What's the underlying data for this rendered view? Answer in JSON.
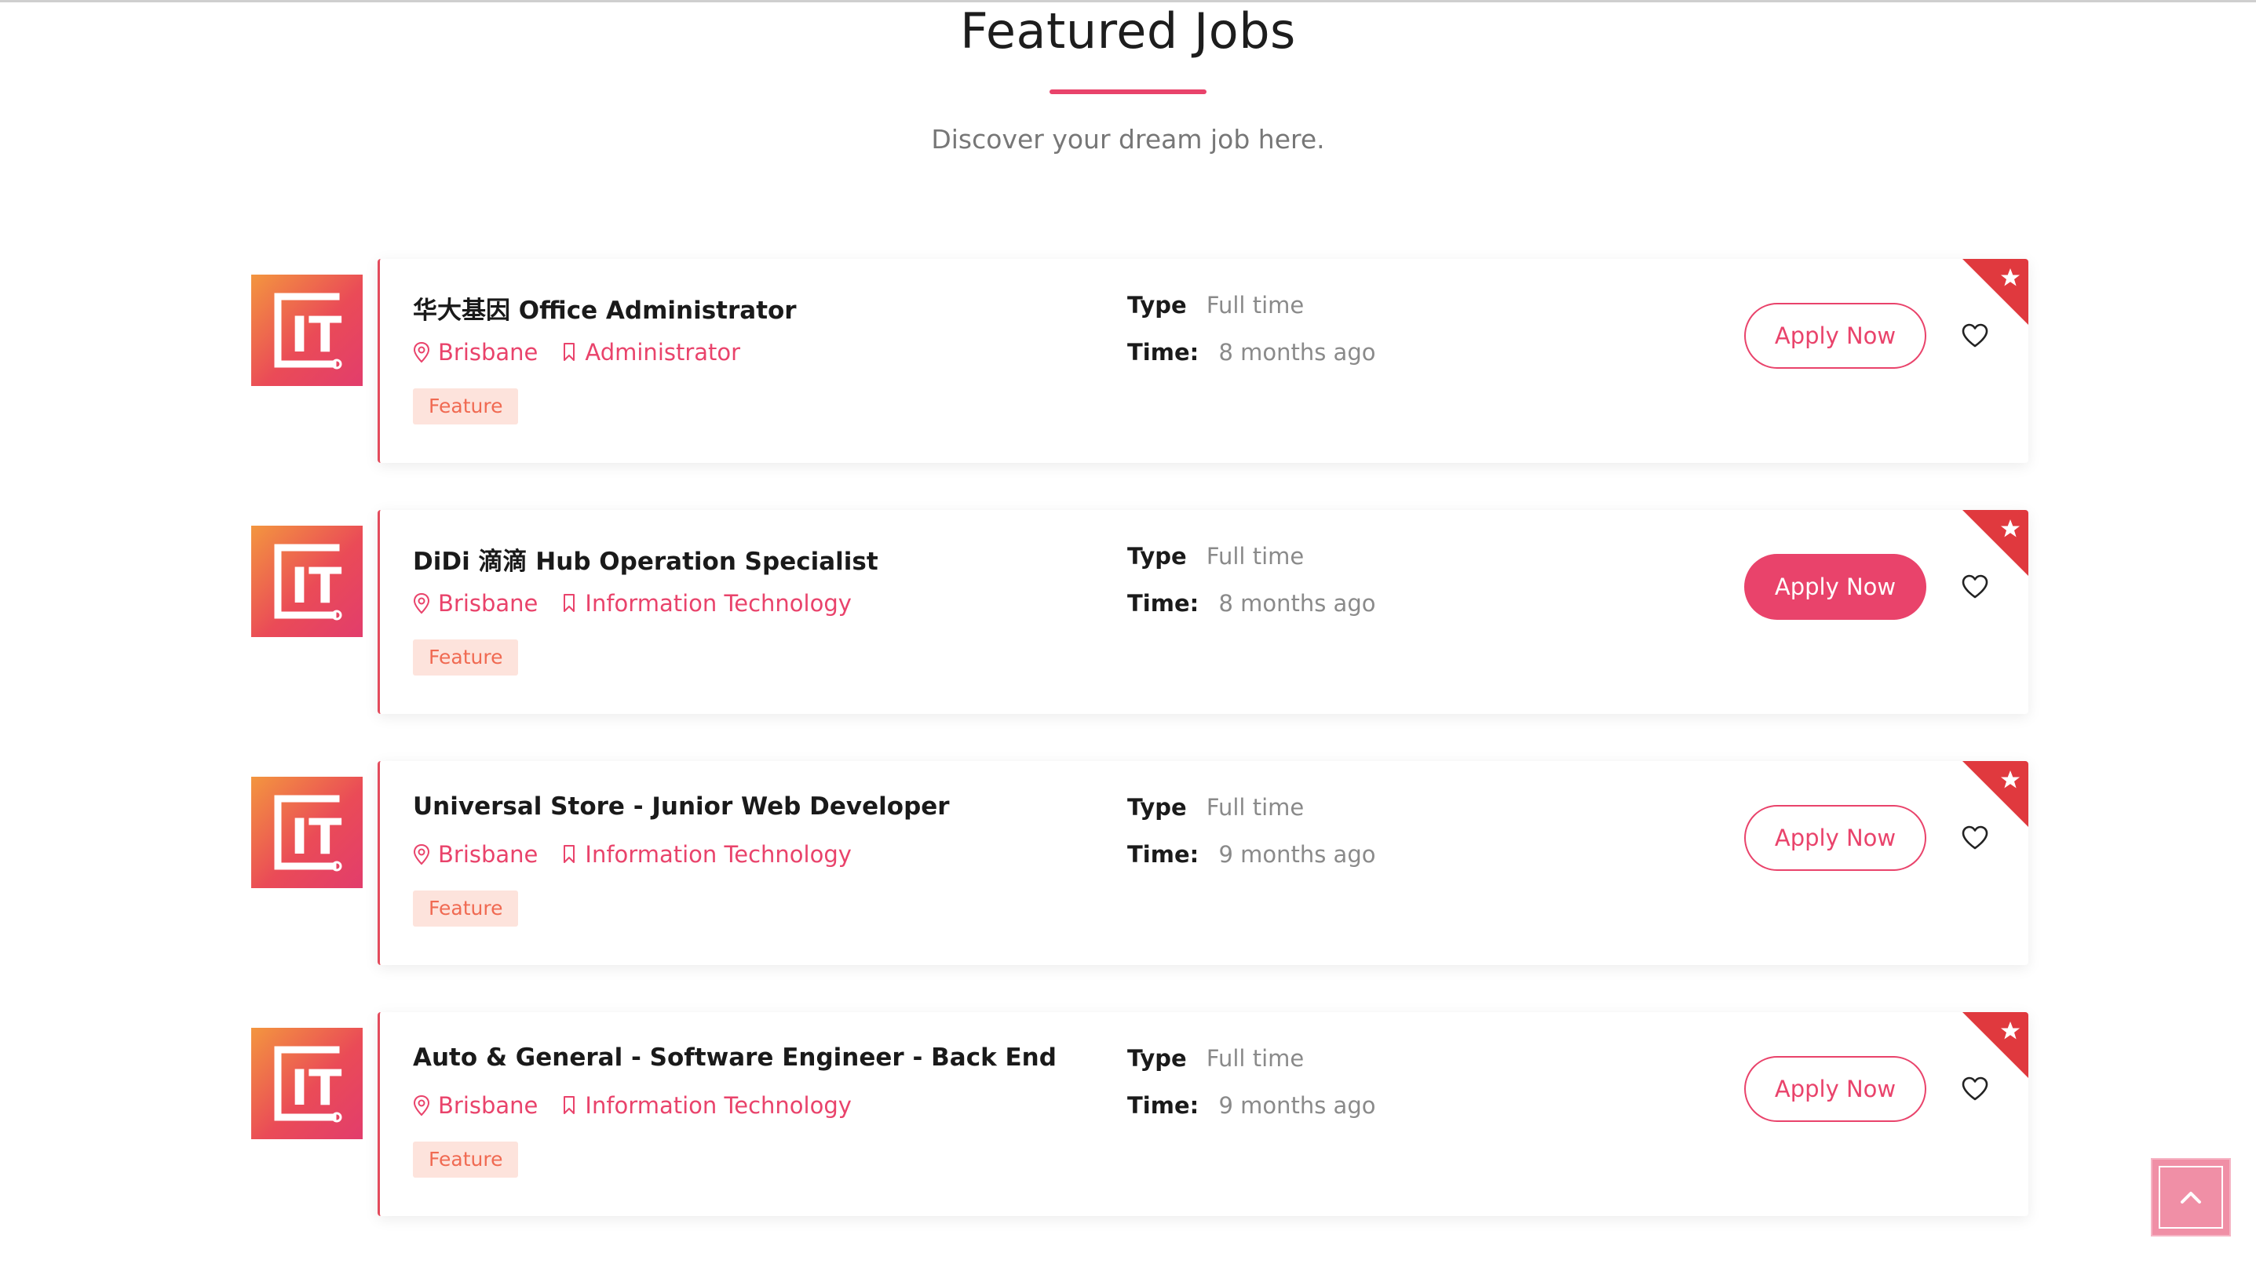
{
  "section": {
    "title": "Featured Jobs",
    "subtitle": "Discover your dream job here."
  },
  "labels": {
    "type": "Type",
    "time": "Time:"
  },
  "colors": {
    "accent": "#e9436b",
    "badge_bg": "#fde3dc",
    "badge_text": "#f06a52",
    "ribbon": "#e0393e"
  },
  "jobs": [
    {
      "title": "华大基因 Office Administrator",
      "location": "Brisbane",
      "category": "Administrator",
      "badge": "Feature",
      "type": "Full time",
      "time": "8 months ago",
      "apply_label": "Apply Now",
      "apply_state": "outline",
      "logo_text": "IT"
    },
    {
      "title": "DiDi 滴滴 Hub Operation Specialist",
      "location": "Brisbane",
      "category": "Information Technology",
      "badge": "Feature",
      "type": "Full time",
      "time": "8 months ago",
      "apply_label": "Apply Now",
      "apply_state": "filled",
      "logo_text": "IT"
    },
    {
      "title": "Universal Store - Junior Web Developer",
      "location": "Brisbane",
      "category": "Information Technology",
      "badge": "Feature",
      "type": "Full time",
      "time": "9 months ago",
      "apply_label": "Apply Now",
      "apply_state": "outline",
      "logo_text": "IT"
    },
    {
      "title": "Auto & General - Software Engineer - Back End",
      "location": "Brisbane",
      "category": "Information Technology",
      "badge": "Feature",
      "type": "Full time",
      "time": "9 months ago",
      "apply_label": "Apply Now",
      "apply_state": "outline",
      "logo_text": "IT"
    }
  ],
  "icons": {
    "location": "map-pin-icon",
    "category": "bookmark-icon",
    "favorite": "heart-icon",
    "featured": "star-icon",
    "scroll_top": "chevron-up-icon"
  }
}
